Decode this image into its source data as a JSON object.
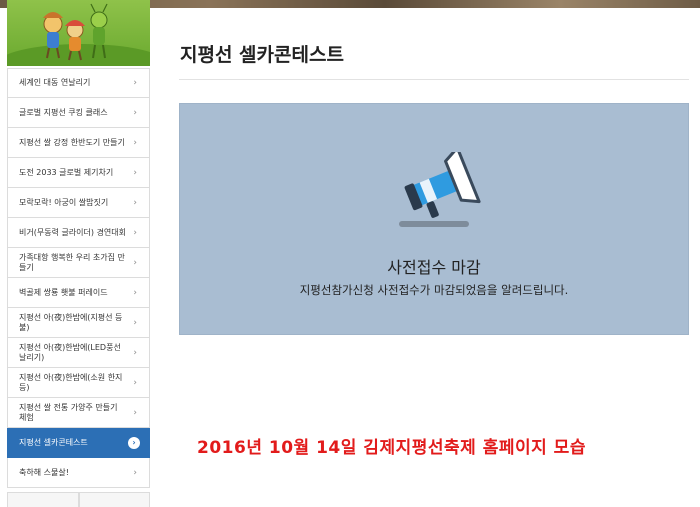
{
  "sidebar": {
    "items": [
      {
        "label": "세계인 대동 연날리기",
        "active": false
      },
      {
        "label": "글로벌 지평선 쿠킹 클래스",
        "active": false
      },
      {
        "label": "지평선 쌀 강정 한반도기 만들기",
        "active": false
      },
      {
        "label": "도전 2033 글로벌 제기차기",
        "active": false
      },
      {
        "label": "모락모락! 아궁이 쌀밥짓기",
        "active": false
      },
      {
        "label": "비거(무동력 글라이더) 경연대회",
        "active": false
      },
      {
        "label": "가족대항 행복한 우리 초가집 만들기",
        "active": false
      },
      {
        "label": "벽골제 쌍룡 횃불 퍼레이드",
        "active": false
      },
      {
        "label": "지평선 아(夜)한밤에(지평선 등불)",
        "active": false
      },
      {
        "label": "지평선 아(夜)한밤에(LED풍선 날리기)",
        "active": false
      },
      {
        "label": "지평선 아(夜)한밤에(소원 한지등)",
        "active": false
      },
      {
        "label": "지평선 쌀 전통 가양주 만들기 체험",
        "active": false
      },
      {
        "label": "지평선 셀카콘테스트",
        "active": true
      },
      {
        "label": "축하해 스물살!",
        "active": false
      }
    ]
  },
  "main": {
    "title": "지평선 셀카콘테스트",
    "notice": {
      "title": "사전접수 마감",
      "description": "지평선참가신청 사전접수가 마감되었음을 알려드립니다."
    }
  },
  "caption": "2016년 10월 14일 김제지평선축제 홈페이지 모습",
  "colors": {
    "accent": "#2c6fb5",
    "notice_bg": "#a9bdd2",
    "caption": "#e21b1b",
    "banner": "#7bb63c"
  },
  "icons": {
    "chevron": "chevron-right-icon",
    "notice": "megaphone-icon"
  }
}
